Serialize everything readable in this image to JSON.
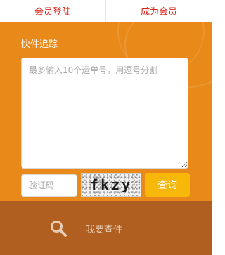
{
  "top_tabs": {
    "login_label": "会员登陆",
    "register_label": "成为会员"
  },
  "tracking": {
    "title": "快件追踪",
    "textarea_placeholder": "最多输入10个运单号，用逗号分割",
    "captcha_placeholder": "验证码",
    "captcha_text": "fkzy",
    "query_label": "查询"
  },
  "bottom": {
    "icon": "search-icon",
    "label": "我要查件"
  },
  "colors": {
    "accent": "#e8891a",
    "button": "#f7b80a",
    "bottom_bar": "#b15f20",
    "tab_text": "#d7261c"
  }
}
